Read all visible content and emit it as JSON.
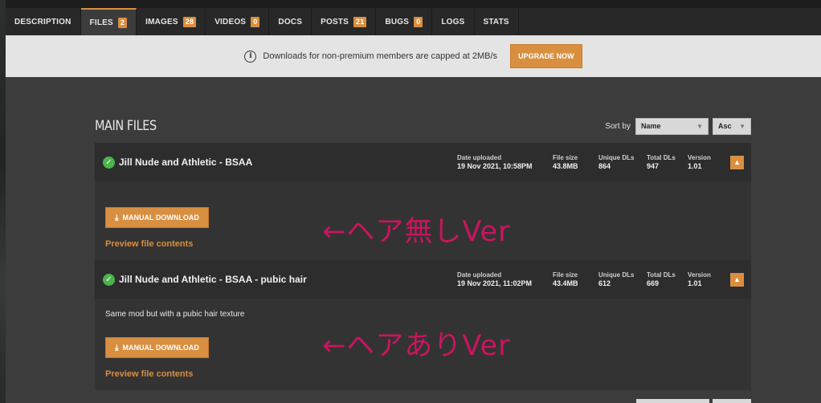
{
  "tabs": [
    {
      "label": "DESCRIPTION",
      "count": null
    },
    {
      "label": "FILES",
      "count": "2"
    },
    {
      "label": "IMAGES",
      "count": "28"
    },
    {
      "label": "VIDEOS",
      "count": "0"
    },
    {
      "label": "DOCS",
      "count": null
    },
    {
      "label": "POSTS",
      "count": "21"
    },
    {
      "label": "BUGS",
      "count": "0"
    },
    {
      "label": "LOGS",
      "count": null
    },
    {
      "label": "STATS",
      "count": null
    }
  ],
  "notice": {
    "text": "Downloads for non-premium members are capped at 2MB/s",
    "upgrade_label": "UPGRADE NOW"
  },
  "section": {
    "title": "MAIN FILES",
    "sort_label": "Sort by",
    "sort_field": "Name",
    "sort_order": "Asc"
  },
  "labels": {
    "date_uploaded": "Date uploaded",
    "file_size": "File size",
    "unique_dls": "Unique DLs",
    "total_dls": "Total DLs",
    "version": "Version",
    "manual_download": "MANUAL DOWNLOAD",
    "preview": "Preview file contents"
  },
  "files": [
    {
      "title": "Jill Nude and Athletic - BSAA",
      "date": "19 Nov 2021, 10:58PM",
      "size": "43.8MB",
      "unique": "864",
      "total": "947",
      "version": "1.01",
      "description": "",
      "annotation": "←ヘア無しVer"
    },
    {
      "title": "Jill Nude and Athletic - BSAA - pubic hair",
      "date": "19 Nov 2021, 11:02PM",
      "size": "43.4MB",
      "unique": "612",
      "total": "669",
      "version": "1.01",
      "description": "Same mod but with a pubic hair texture",
      "annotation": "←ヘアありVer"
    }
  ],
  "colors": {
    "accent": "#d98f40",
    "annotation": "#c8155f",
    "check": "#4bb34b"
  }
}
